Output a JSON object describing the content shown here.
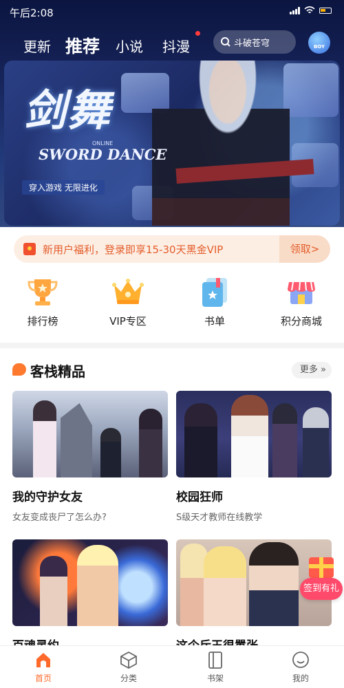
{
  "status_bar": {
    "time": "午后2:08"
  },
  "top_tabs": [
    {
      "label": "更新",
      "active": false
    },
    {
      "label": "推荐",
      "active": true
    },
    {
      "label": "小说",
      "active": false
    },
    {
      "label": "抖漫",
      "active": false
    }
  ],
  "search": {
    "placeholder": "斗破苍穹"
  },
  "boy_button": {
    "label": "BOY"
  },
  "hero_banner": {
    "title_cn": "剑舞",
    "title_en": "SWORD DANCE",
    "online_tag": "ONLINE",
    "tagline": "穿入游戏 无限进化",
    "dot_count": 3,
    "active_dot": 0
  },
  "promo": {
    "text": "新用户福利，登录即享15-30天黑金VIP",
    "button": "领取>"
  },
  "quick_entries": [
    {
      "label": "排行榜",
      "icon": "trophy-icon"
    },
    {
      "label": "VIP专区",
      "icon": "crown-icon"
    },
    {
      "label": "书单",
      "icon": "booklist-icon"
    },
    {
      "label": "积分商城",
      "icon": "shop-icon"
    }
  ],
  "section": {
    "title": "客栈精品",
    "more": "更多"
  },
  "cards": [
    {
      "title": "我的守护女友",
      "subtitle": "女友变成丧尸了怎么办?"
    },
    {
      "title": "校园狂师",
      "subtitle": "S级天才教师在线教学"
    },
    {
      "title": "百魂灵约",
      "subtitle": ""
    },
    {
      "title": "这个斥王很嚣张",
      "subtitle": ""
    }
  ],
  "sign_badge": "签到有礼",
  "bottom_nav": [
    {
      "label": "首页",
      "icon": "home-icon",
      "active": true
    },
    {
      "label": "分类",
      "icon": "category-icon",
      "active": false
    },
    {
      "label": "书架",
      "icon": "bookshelf-icon",
      "active": false
    },
    {
      "label": "我的",
      "icon": "profile-icon",
      "active": false
    }
  ],
  "colors": {
    "accent": "#ff6a2a",
    "promo_text": "#e35d2a",
    "promo_bg": "#fdeee4",
    "header_bg": "#17245a"
  }
}
